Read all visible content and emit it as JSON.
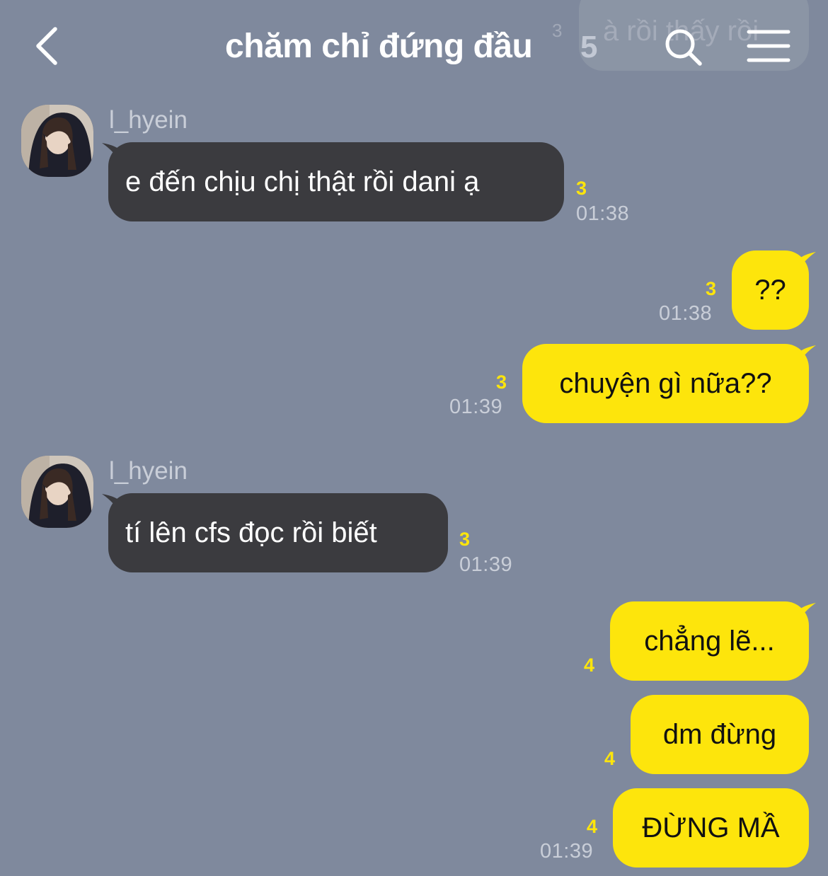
{
  "header": {
    "title": "chăm chỉ đứng đầu",
    "member_count": "5",
    "ghost_preview_text": "à rồi thấy rồi",
    "ghost_preview_count": "3"
  },
  "messages": [
    {
      "direction": "incoming",
      "sender": "l_hyein",
      "text": "e đến chịu chị thật rồi dani ạ",
      "unread": "3",
      "time": "01:38"
    },
    {
      "direction": "outgoing",
      "text": "??",
      "unread": "3",
      "time": "01:38"
    },
    {
      "direction": "outgoing",
      "text": "chuyện gì nữa??",
      "unread": "3",
      "time": "01:39"
    },
    {
      "direction": "incoming",
      "sender": "l_hyein",
      "text": "tí lên cfs đọc rồi biết",
      "unread": "3",
      "time": "01:39"
    },
    {
      "direction": "outgoing",
      "text": "chẳng lẽ...",
      "unread": "4",
      "time": ""
    },
    {
      "direction": "outgoing",
      "text": "dm đừng",
      "unread": "4",
      "time": ""
    },
    {
      "direction": "outgoing",
      "text": "ĐỪNG MẦ",
      "unread": "4",
      "time": "01:39"
    }
  ],
  "colors": {
    "background": "#7f899d",
    "incoming_bubble": "#3b3b3f",
    "outgoing_bubble": "#fde50c",
    "unread_count": "#fde50c",
    "meta_text": "#c9ced8"
  },
  "icons": {
    "back": "chevron-left-icon",
    "search": "search-icon",
    "menu": "hamburger-menu-icon"
  }
}
